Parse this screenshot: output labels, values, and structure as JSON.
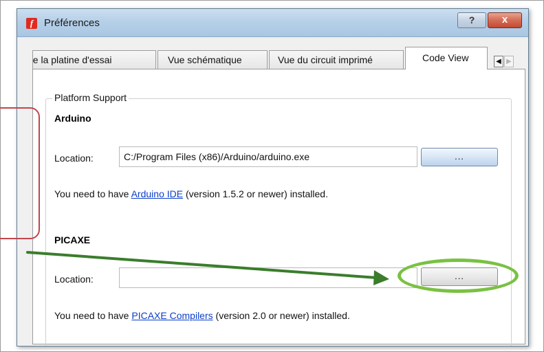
{
  "window": {
    "app_icon_glyph": "f",
    "title": "Préférences",
    "help_glyph": "?",
    "close_glyph": "x"
  },
  "tabs": [
    {
      "label": "de la platine d'essai",
      "active": false
    },
    {
      "label": "Vue schématique",
      "active": false
    },
    {
      "label": "Vue du circuit imprimé",
      "active": false
    },
    {
      "label": "Code View",
      "active": true
    }
  ],
  "tab_scroll": {
    "left_glyph": "◀",
    "right_glyph": "▶"
  },
  "group": {
    "title": "Platform Support"
  },
  "arduino": {
    "heading": "Arduino",
    "location_label": "Location:",
    "location_value": "C:/Program Files (x86)/Arduino/arduino.exe",
    "browse_label": "...",
    "note_prefix": "You need to have ",
    "note_link": "Arduino IDE",
    "note_suffix": " (version 1.5.2 or newer) installed."
  },
  "picaxe": {
    "heading": "PICAXE",
    "location_label": "Location:",
    "location_value": "",
    "browse_label": "...",
    "note_prefix": "You need to have ",
    "note_link": "PICAXE Compilers",
    "note_suffix": " (version 2.0 or newer) installed."
  },
  "annotations": {
    "bracket_color": "#c1454d",
    "arrow_color": "#3a7d2c",
    "ellipse_color": "#7ac143"
  }
}
